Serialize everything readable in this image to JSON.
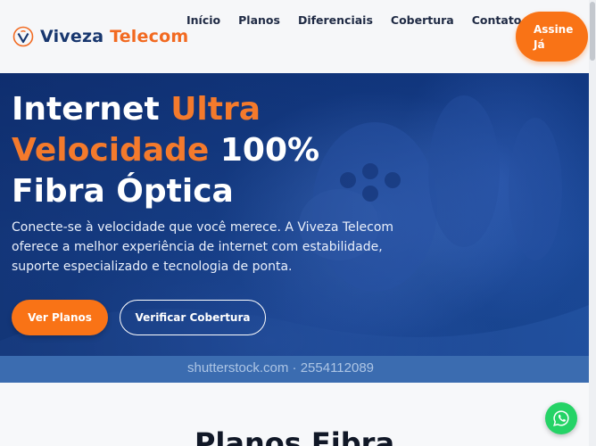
{
  "header": {
    "brand_part1": "Viveza",
    "brand_part2": "Telecom",
    "logo_letter": "V",
    "nav": [
      "Início",
      "Planos",
      "Diferenciais",
      "Cobertura",
      "Contato"
    ],
    "cta_line1": "Assine",
    "cta_line2": "Já"
  },
  "hero": {
    "title_part1": "Internet ",
    "title_highlight1": "Ultra",
    "title_highlight2": "Velocidade",
    "title_part2": " 100%",
    "title_part3": "Fibra Óptica",
    "subtitle": "Conecte-se à velocidade que você merece. A Viveza Telecom oferece a melhor experiência de internet com estabilidade, suporte especializado e tecnologia de ponta.",
    "primary_button": "Ver Planos",
    "secondary_button": "Verificar Cobertura",
    "watermark": "shutterstock.com · 2554112089"
  },
  "plans": {
    "title": "Planos Fibra"
  },
  "colors": {
    "accent": "#f97316",
    "brand_blue": "#17366e",
    "whatsapp": "#25d366"
  },
  "icons": {
    "logo": "wifi-v-logo-icon",
    "whatsapp": "whatsapp-icon"
  }
}
